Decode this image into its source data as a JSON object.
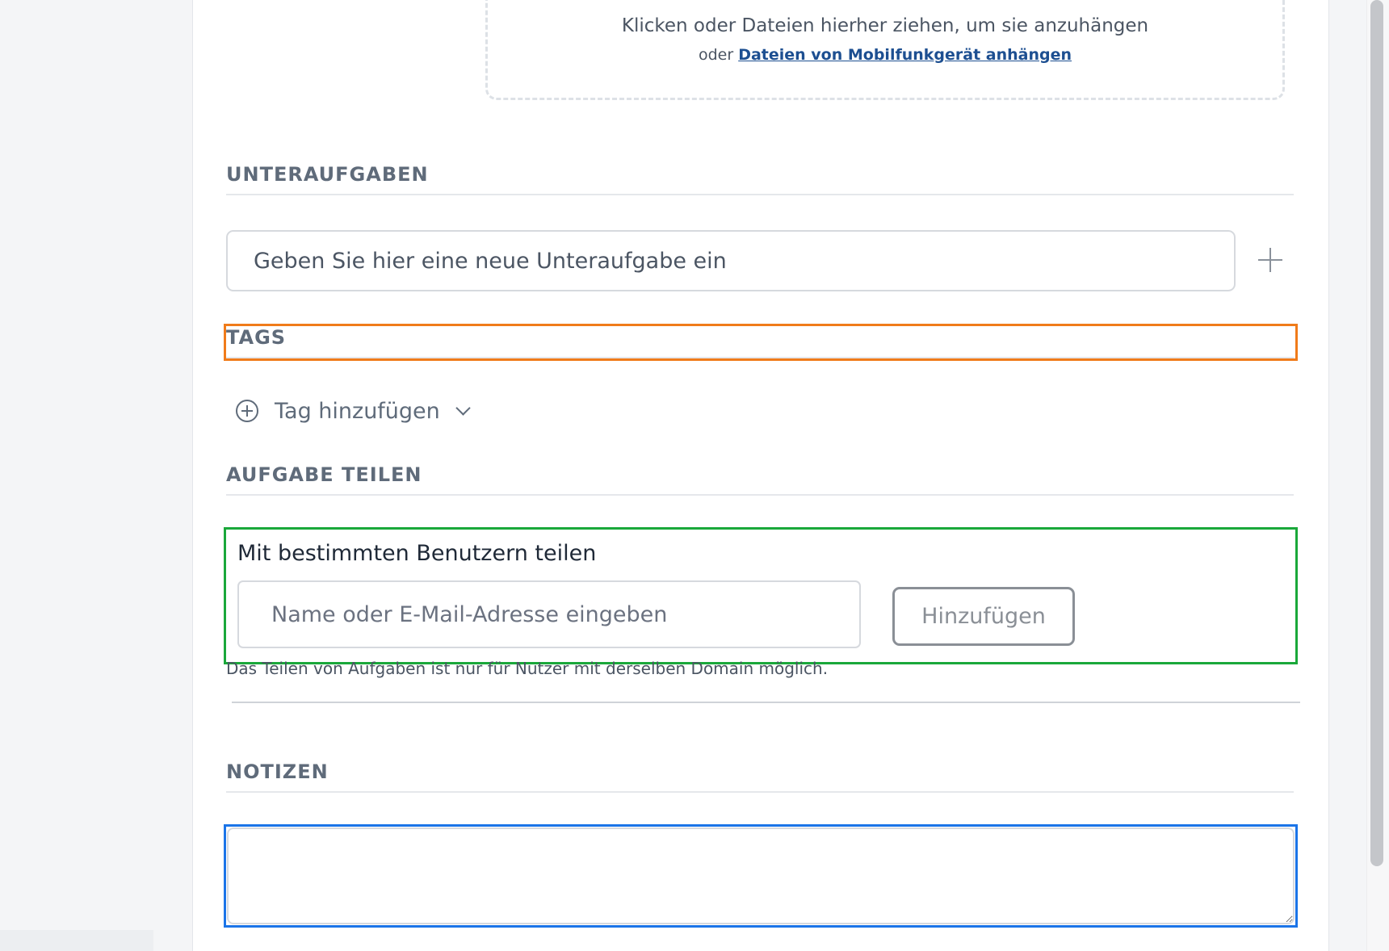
{
  "dropzone": {
    "main_text": "Klicken oder Dateien hierher ziehen, um sie anzuhängen",
    "sub_prefix": "oder",
    "sub_link": "Dateien von Mobilfunkgerät anhängen"
  },
  "subtasks": {
    "heading": "UNTERAUFGABEN",
    "input_placeholder": "Geben Sie hier eine neue Unteraufgabe ein",
    "add_icon": "plus-icon"
  },
  "tags": {
    "heading": "TAGS",
    "add_label": "Tag hinzufügen",
    "add_icon": "plus-circle-icon",
    "dropdown_icon": "chevron-down-icon"
  },
  "share": {
    "heading": "AUFGABE TEILEN",
    "label": "Mit bestimmten Benutzern teilen",
    "input_placeholder": "Name oder E-Mail-Adresse eingeben",
    "button_label": "Hinzufügen",
    "hint": "Das Teilen von Aufgaben ist nur für Nutzer mit derselben Domain möglich."
  },
  "notes": {
    "heading": "NOTIZEN",
    "value": ""
  },
  "colors": {
    "link": "#1d4f91",
    "highlight_orange": "#f07b1a",
    "highlight_green": "#1aa83a",
    "highlight_blue": "#1b74e8",
    "heading_text": "#5f6b7a"
  }
}
